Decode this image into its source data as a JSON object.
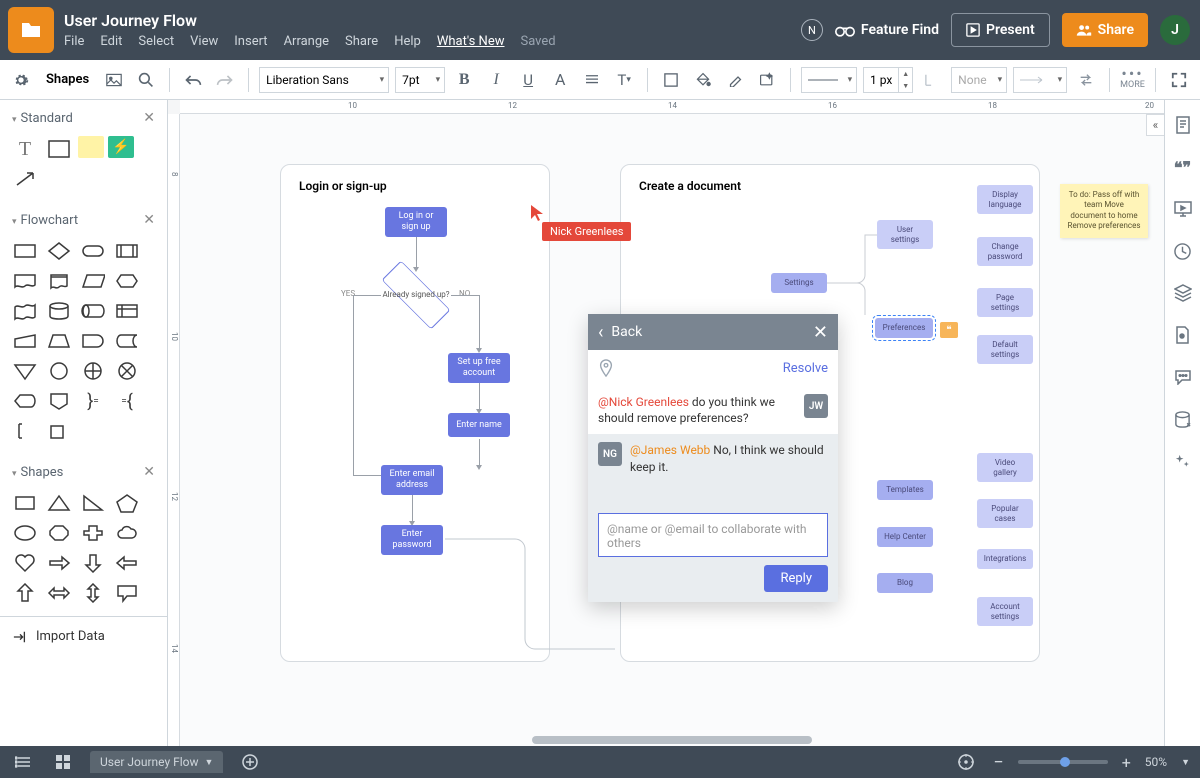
{
  "header": {
    "title": "User Journey Flow",
    "menu": [
      "File",
      "Edit",
      "Select",
      "View",
      "Insert",
      "Arrange",
      "Share",
      "Help"
    ],
    "whats_new": "What's New",
    "saved": "Saved",
    "n_badge": "N",
    "feature_find": "Feature Find",
    "present": "Present",
    "share": "Share",
    "avatar": "J"
  },
  "toolbar": {
    "shapes": "Shapes",
    "font": "Liberation Sans",
    "font_size": "7pt",
    "stroke_width": "1 px",
    "fill_label": "None",
    "more": "MORE"
  },
  "sidebar": {
    "standard": "Standard",
    "flowchart": "Flowchart",
    "shapes": "Shapes",
    "import": "Import Data"
  },
  "ruler_h": {
    "t10": "10",
    "t12": "12",
    "t14": "14",
    "t16": "16",
    "t18": "18",
    "t20": "20"
  },
  "ruler_v": {
    "t8": "8",
    "t10": "10",
    "t12": "12",
    "t14": "14"
  },
  "canvas": {
    "page1": {
      "title": "Login or sign-up",
      "login": "Log in or sign up",
      "decision": "Already signed up?",
      "yes": "YES",
      "no": "NO",
      "setup": "Set up free account",
      "enter_name": "Enter name",
      "enter_email": "Enter email address",
      "enter_password": "Enter password"
    },
    "page2": {
      "title": "Create a document",
      "settings": "Settings",
      "user_settings": "User settings",
      "display_lang": "Display language",
      "change_pw": "Change password",
      "page_settings": "Page settings",
      "preferences": "Preferences",
      "default_settings": "Default settings",
      "video": "Video gallery",
      "popular": "Popular cases",
      "templates": "Templates",
      "help_center": "Help Center",
      "blog": "Blog",
      "integrations": "Integrations",
      "account": "Account settings"
    },
    "remote_user": "Nick Greenlees",
    "sticky": "To do:\nPass off with team\nMove document to home\nRemove preferences"
  },
  "comments": {
    "back": "Back",
    "resolve": "Resolve",
    "msg1": {
      "avatar": "JW",
      "mention": "@Nick Greenlees",
      "text": " do you think we should remove preferences?"
    },
    "msg2": {
      "avatar": "NG",
      "mention": "@James Webb",
      "text": " No, I think we should keep it."
    },
    "placeholder": "@name or @email to collaborate with others",
    "reply": "Reply"
  },
  "footer": {
    "tab": "User Journey Flow",
    "zoom": "50%"
  }
}
